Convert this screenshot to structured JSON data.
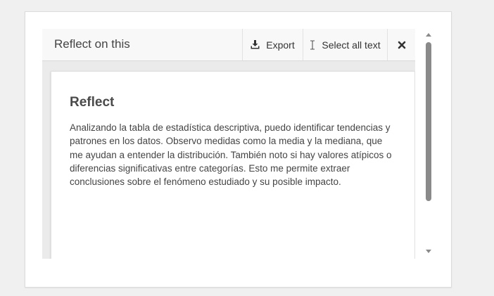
{
  "header": {
    "title": "Reflect on this",
    "export_label": "Export",
    "select_all_label": "Select all text"
  },
  "content": {
    "title": "Reflect",
    "body": "Analizando la tabla de estadística descriptiva, puedo identificar tendencias y patrones en los datos. Observo medidas como la media y la mediana, que me ayudan a entender la distribución. También noto si hay valores atípicos o diferencias significativas entre categorías. Esto me permite extraer conclusiones sobre el fenómeno estudiado y su posible impacto."
  },
  "icons": {
    "export": "download-icon",
    "select_all": "text-cursor-icon",
    "close": "close-icon"
  },
  "colors": {
    "header_bg": "#f8f8f8",
    "panel_bg": "#ebebeb",
    "text": "#444444",
    "scrollbar": "#8a8a8a"
  }
}
